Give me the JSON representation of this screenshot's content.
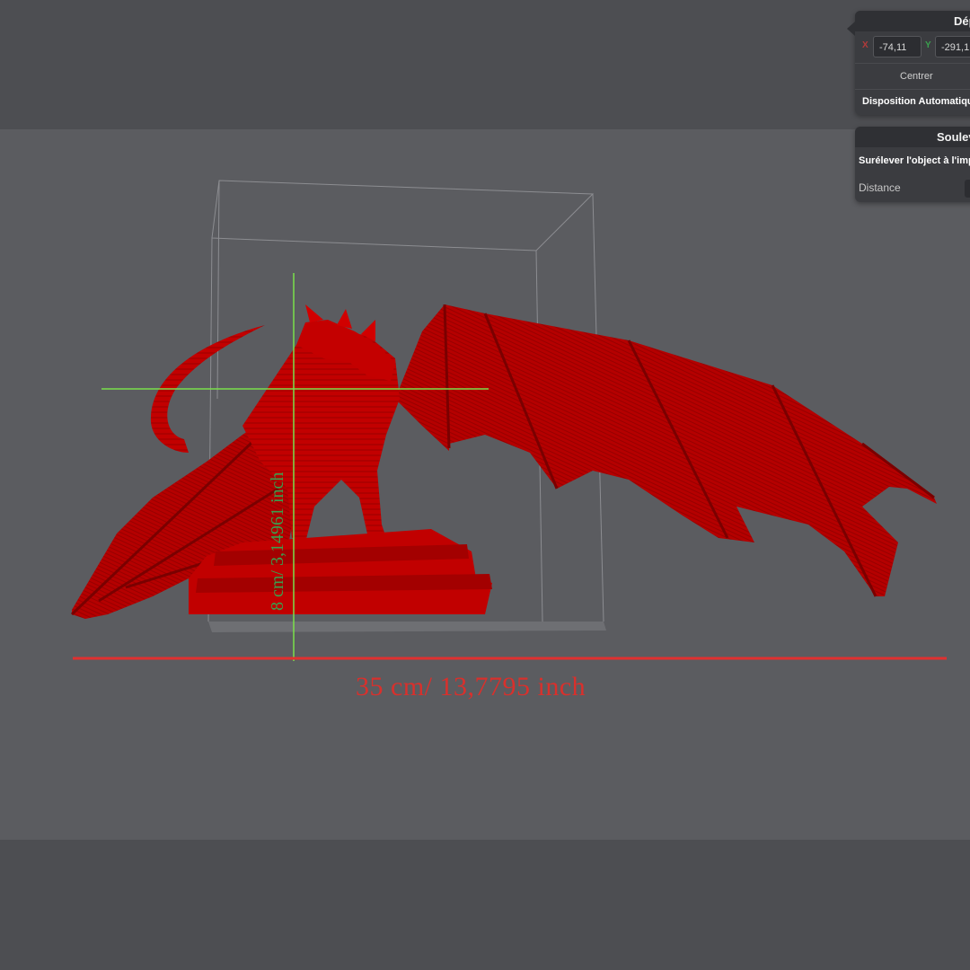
{
  "viewport": {
    "model_name": "red-dragon-model",
    "colors": {
      "model": "#c00000",
      "width_line": "#e03030",
      "height_line": "#7be04a",
      "label_height": "#3aa04e"
    }
  },
  "measurements": {
    "width_label": "35 cm/ 13,7795 inch",
    "height_label": "8 cm/ 3,14961 inch"
  },
  "move_panel": {
    "title": "Dép",
    "x_axis": "X",
    "x_value": "-74,11",
    "y_axis": "Y",
    "y_value": "-291,1",
    "center_button": "Centrer",
    "auto_layout": "Disposition Automatique"
  },
  "lift_panel": {
    "title": "Soulev",
    "raise_label": "Surélever l'object à l'imp",
    "distance_label": "Distance"
  }
}
